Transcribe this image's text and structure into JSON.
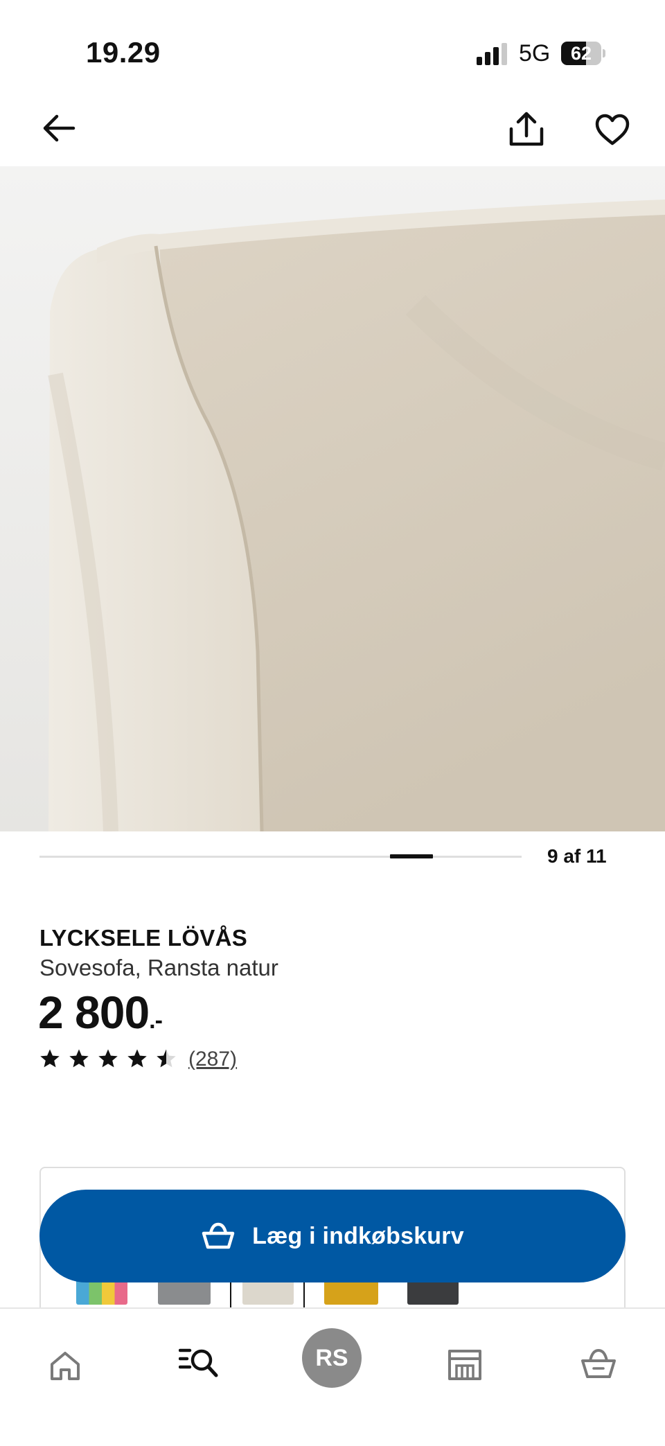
{
  "status_bar": {
    "time": "19.29",
    "network": "5G",
    "battery_percent": "62",
    "battery_level": 0.62
  },
  "nav": {
    "back_icon": "arrow-left-icon",
    "share_icon": "share-icon",
    "favorite_icon": "heart-icon"
  },
  "gallery": {
    "counter": "9 af 11",
    "current": 9,
    "total": 11
  },
  "product": {
    "name": "LYCKSELE LÖVÅS",
    "description": "Sovesofa, Ransta natur",
    "price": "2 800",
    "price_suffix": ".-",
    "rating": 4.5,
    "rating_max": 5,
    "review_count": "(287)"
  },
  "cart": {
    "button_label": "Læg i indkøbskurv",
    "icon": "basket-icon"
  },
  "color_swatches": [
    "#4aa8d6",
    "#8a8c8e",
    "#dcd7cc",
    "#d6a21a",
    "#3b3c3e"
  ],
  "tab_bar": {
    "profile_initials": "RS",
    "items": [
      "home-icon",
      "search-list-icon",
      "profile-avatar",
      "store-icon",
      "basket-icon"
    ]
  }
}
